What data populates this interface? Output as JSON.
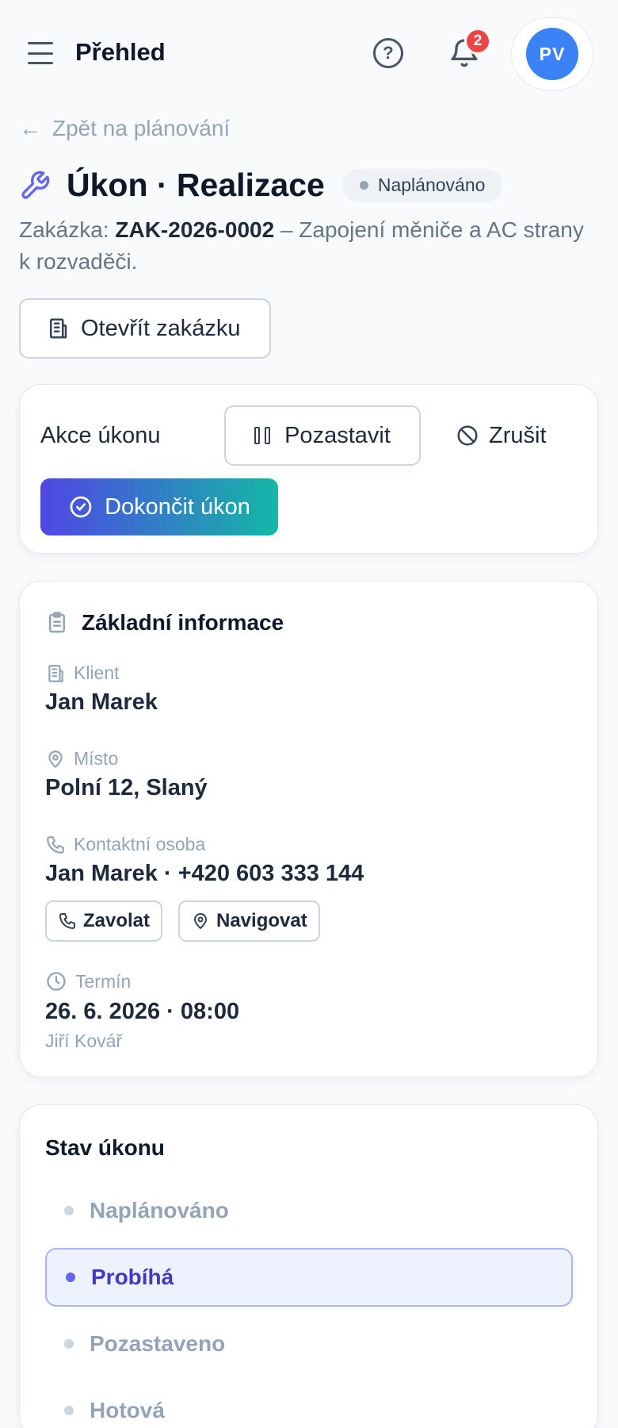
{
  "header": {
    "title": "Přehled",
    "notifications_count": "2",
    "avatar_initials": "PV"
  },
  "back_link": "Zpět na plánování",
  "page": {
    "title": "Úkon · Realizace",
    "status": "Naplánováno",
    "order_prefix": "Zakázka: ",
    "order_code": "ZAK-2026-0002",
    "order_desc": " – Zapojení měniče a AC strany k rozvaděči.",
    "open_order_label": "Otevřít zakázku"
  },
  "actions": {
    "label": "Akce úkonu",
    "pause_label": "Pozastavit",
    "cancel_label": "Zrušit",
    "finish_label": "Dokončit úkon"
  },
  "info": {
    "title": "Základní informace",
    "client_label": "Klient",
    "client_value": "Jan Marek",
    "place_label": "Místo",
    "place_value": "Polní 12, Slaný",
    "contact_label": "Kontaktní osoba",
    "contact_value": "Jan Marek · +420 603 333 144",
    "call_label": "Zavolat",
    "navigate_label": "Navigovat",
    "term_label": "Termín",
    "term_value": "26. 6. 2026 · 08:00",
    "term_person": "Jiří Kovář"
  },
  "state": {
    "title": "Stav úkonu",
    "items": [
      {
        "label": "Naplánováno",
        "active": false
      },
      {
        "label": "Probíhá",
        "active": true
      },
      {
        "label": "Pozastaveno",
        "active": false
      },
      {
        "label": "Hotová",
        "active": false
      }
    ]
  },
  "colors": {
    "accent": "#4f46e5",
    "teal": "#14b8a6",
    "badge": "#ef4444",
    "avatar": "#3b82f6"
  }
}
